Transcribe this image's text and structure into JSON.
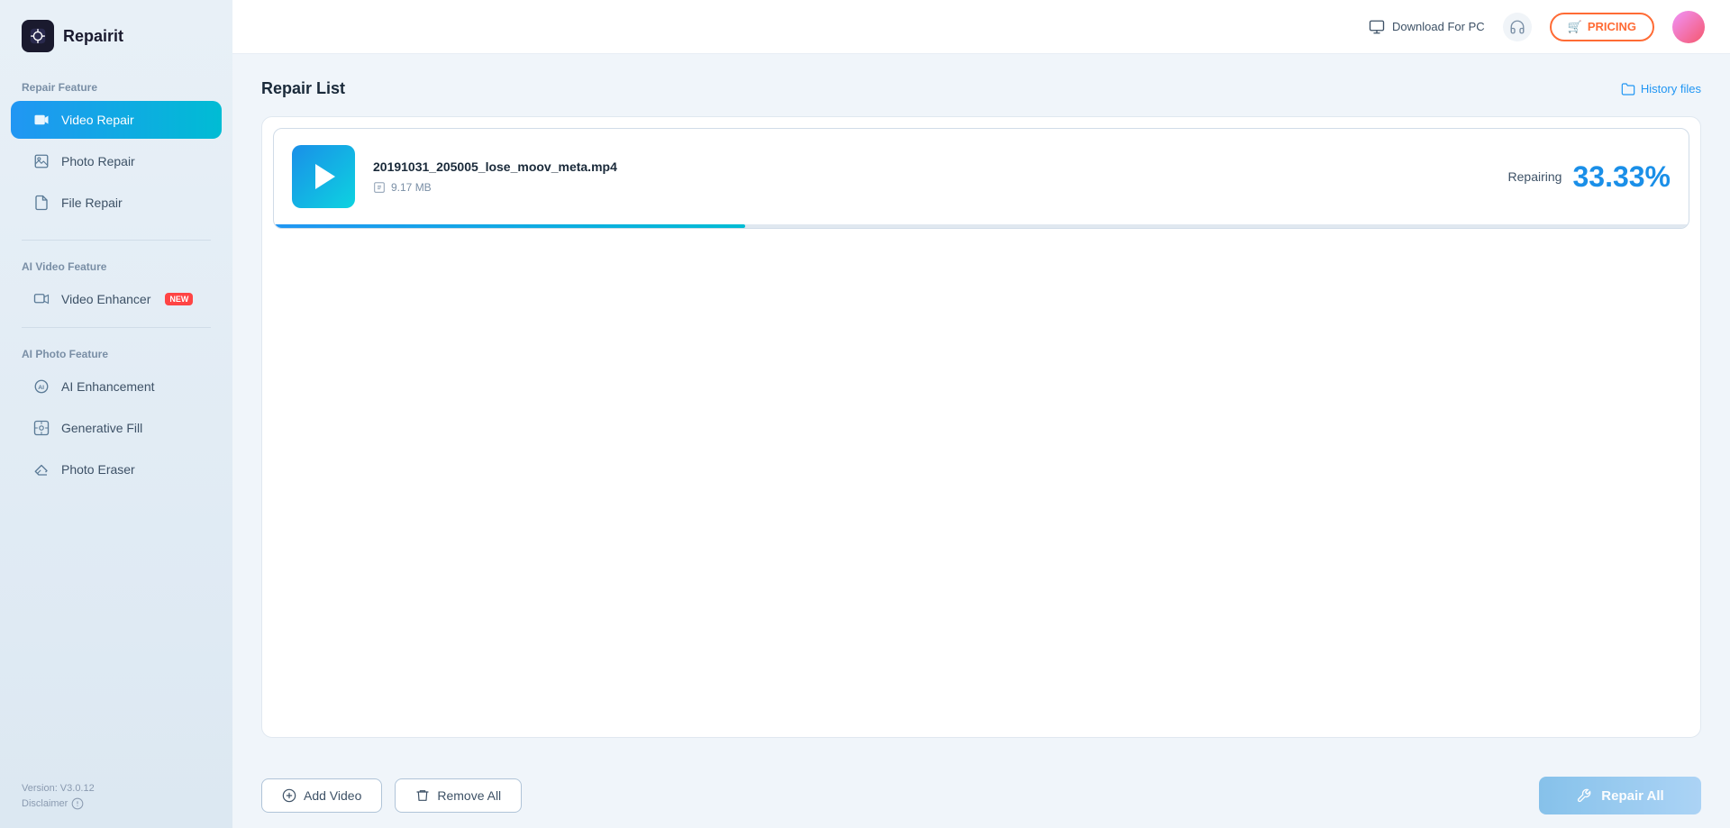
{
  "app": {
    "name": "Repairit"
  },
  "header": {
    "download_label": "Download For PC",
    "pricing_label": "PRICING",
    "pricing_icon": "🛒"
  },
  "sidebar": {
    "repair_feature_title": "Repair Feature",
    "items": [
      {
        "id": "video-repair",
        "label": "Video Repair",
        "active": true
      },
      {
        "id": "photo-repair",
        "label": "Photo Repair",
        "active": false
      },
      {
        "id": "file-repair",
        "label": "File Repair",
        "active": false
      }
    ],
    "ai_video_title": "AI Video Feature",
    "ai_video_items": [
      {
        "id": "video-enhancer",
        "label": "Video Enhancer",
        "badge": "NEW"
      }
    ],
    "ai_photo_title": "AI Photo Feature",
    "ai_photo_items": [
      {
        "id": "ai-enhancement",
        "label": "AI Enhancement"
      },
      {
        "id": "generative-fill",
        "label": "Generative Fill"
      },
      {
        "id": "photo-eraser",
        "label": "Photo Eraser"
      }
    ],
    "version": "Version: V3.0.12",
    "disclaimer": "Disclaimer"
  },
  "content": {
    "repair_list_title": "Repair List",
    "history_files_label": "History files",
    "file": {
      "name": "20191031_205005_lose_moov_meta.mp4",
      "size": "9.17 MB",
      "status": "Repairing",
      "progress": "33.33%",
      "progress_value": 33.33
    },
    "add_video_label": "Add Video",
    "remove_all_label": "Remove All",
    "repair_all_label": "Repair All"
  }
}
